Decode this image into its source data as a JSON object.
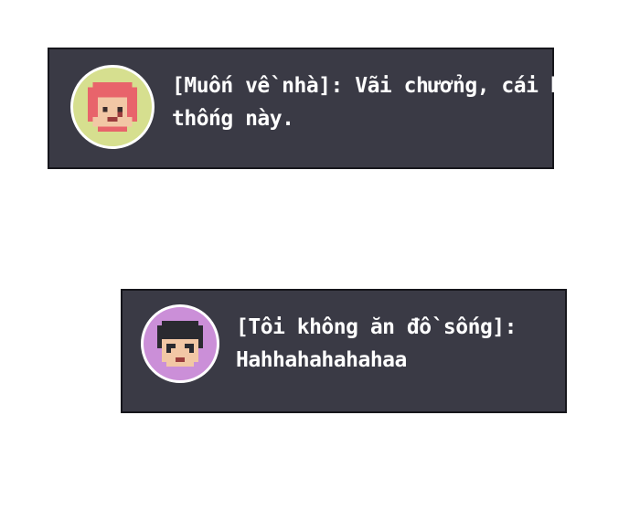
{
  "messages": [
    {
      "sender": "[Muốn về nhà]:",
      "line1_text": "Vãi chưởng, cái hệ",
      "line2_text": "thống này.",
      "avatar_icon": "red-hair-girl-pixel-avatar",
      "avatar_bg": "#d6df8f"
    },
    {
      "sender": "[Tôi không ăn đồ sống]:",
      "line2_text": "Hahhahahahahaa",
      "avatar_icon": "black-hair-pixel-avatar",
      "avatar_bg": "#cb8fd8"
    }
  ],
  "colors": {
    "box_bg": "#3a3a45",
    "box_border": "#16161c",
    "text": "#ffffff"
  }
}
